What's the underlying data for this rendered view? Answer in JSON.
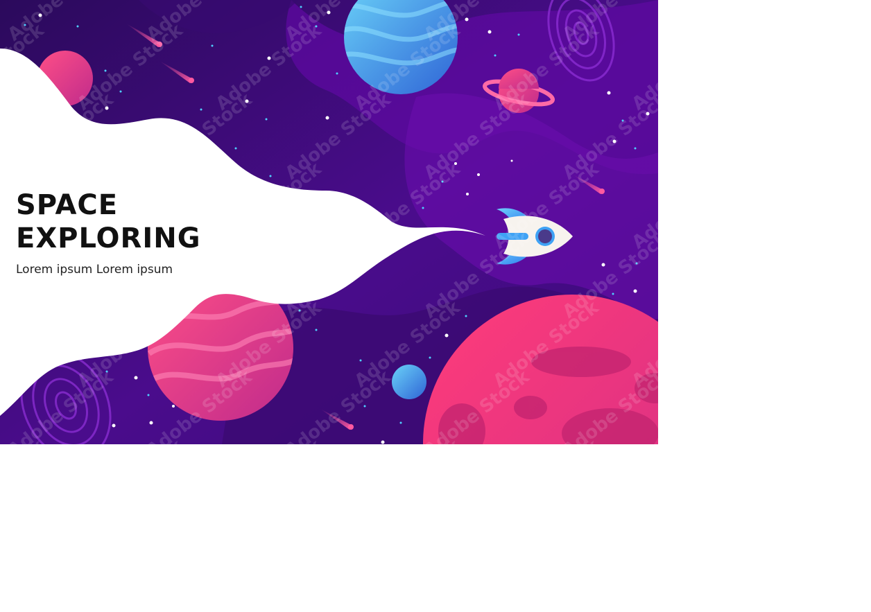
{
  "banner": {
    "headline_line1": "SPACE",
    "headline_line2": "EXPLORING",
    "tagline": "Lorem ipsum  Lorem ipsum",
    "watermark_text": "Adobe Stock"
  },
  "colors": {
    "space_dark": "#2b0a5c",
    "space_mid": "#5a0a9a",
    "space_light": "#7416b8",
    "cloud": "#ffffff",
    "headline_text": "#111111",
    "tagline_text": "#222222",
    "planet_blue_a": "#6ad2f8",
    "planet_blue_b": "#2f64d6",
    "planet_pink_a": "#ff4f86",
    "planet_pink_b": "#c02b8c",
    "rocket_body": "#f7f3ee",
    "rocket_fin": "#3fa2f5",
    "rocket_window": "#4a3a8a"
  },
  "icons": {
    "rocket": "rocket-icon",
    "planets": "planet-icon",
    "stars": "star-icon",
    "comets": "comet-icon"
  }
}
